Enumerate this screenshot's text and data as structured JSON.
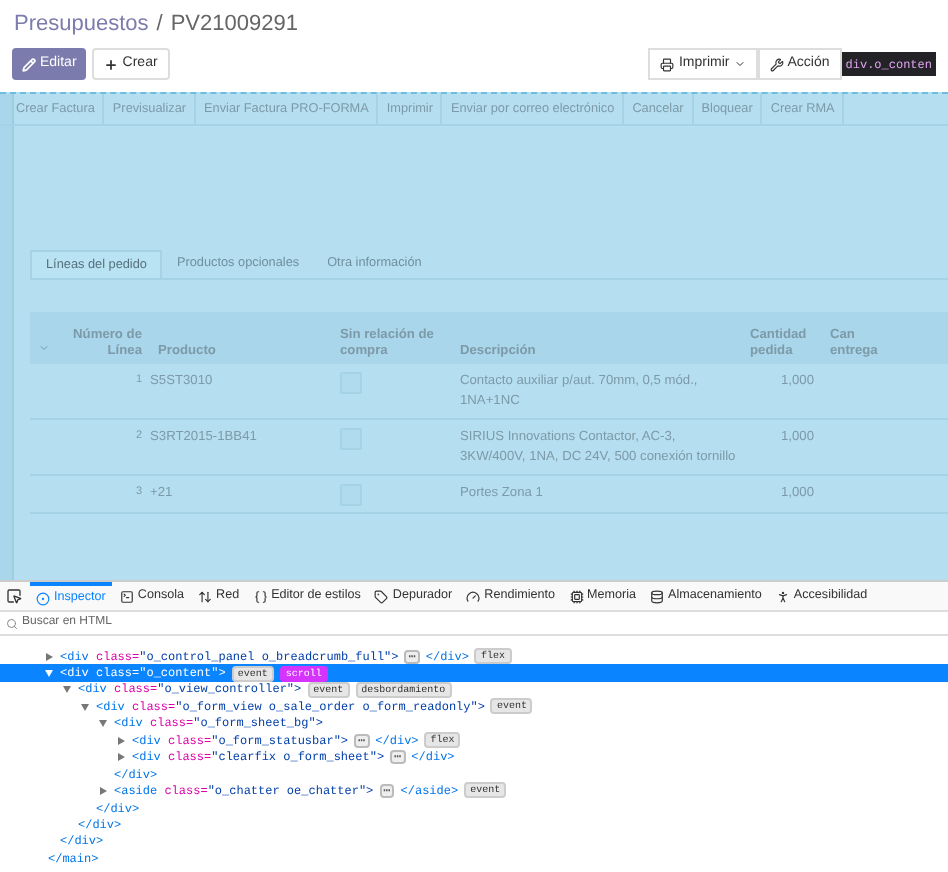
{
  "breadcrumb": {
    "parent": "Presupuestos",
    "separator": "/",
    "current": "PV21009291"
  },
  "buttons": {
    "left": [
      {
        "label": "Editar",
        "kind": "primary"
      },
      {
        "label": "Crear",
        "kind": "create"
      }
    ],
    "right": [
      {
        "label": "Imprimir",
        "kind": "print"
      },
      {
        "label": "Acción",
        "kind": "action"
      }
    ]
  },
  "element_tooltip": "div.o_conten",
  "statusbar_buttons": [
    "Crear Factura",
    "Previsualizar",
    "Enviar Factura PRO-FORMA",
    "Imprimir",
    "Enviar por correo electrónico",
    "Cancelar",
    "Bloquear",
    "Crear RMA"
  ],
  "tabs": [
    {
      "label": "Líneas del pedido",
      "selected": true
    },
    {
      "label": "Productos opcionales",
      "selected": false
    },
    {
      "label": "Otra información",
      "selected": false
    }
  ],
  "table": {
    "columns": [
      "Número de Línea",
      "Producto",
      "Sin relación de compra",
      "Descripción",
      "Cantidad pedida",
      "Can entrega"
    ],
    "rows": [
      {
        "number": "1",
        "product": "S5ST3010",
        "checked": false,
        "description": "Contacto auxiliar p/aut. 70mm, 0,5 mód., 1NA+1NC",
        "quantity": "1,000"
      },
      {
        "number": "2",
        "product": "S3RT2015-1BB41",
        "checked": false,
        "description": "SIRIUS Innovations Contactor, AC-3, 3KW/400V, 1NA, DC 24V, 500 conexión tornillo",
        "quantity": "1,000"
      },
      {
        "number": "3",
        "product": "+21",
        "checked": false,
        "description": "Portes  Zona 1",
        "quantity": "1,000"
      }
    ]
  },
  "devtools": {
    "tools": [
      {
        "label": "Inspector",
        "kind": "inspector",
        "selected": true
      },
      {
        "label": "Consola",
        "kind": "console",
        "selected": false
      },
      {
        "label": "Red",
        "kind": "network",
        "selected": false
      },
      {
        "label": "Editor de estilos",
        "kind": "style",
        "selected": false
      },
      {
        "label": "Depurador",
        "kind": "debugger",
        "selected": false
      },
      {
        "label": "Rendimiento",
        "kind": "performance",
        "selected": false
      },
      {
        "label": "Memoria",
        "kind": "memory",
        "selected": false
      },
      {
        "label": "Almacenamiento",
        "kind": "storage",
        "selected": false
      },
      {
        "label": "Accesibilidad",
        "kind": "accessibility",
        "selected": false
      }
    ],
    "search": {
      "placeholder": "Buscar en HTML"
    },
    "tree": {
      "closing": "</main>",
      "children": [
        {
          "tag": "<div",
          "attr": " class=",
          "value": "\"o_control_panel o_breadcrumb_full\">",
          "expanded": false,
          "selected": false,
          "ellipsis": "⋯",
          "closing": "</div>",
          "badges": [
            {
              "label": "flex",
              "kind": "plain"
            }
          ]
        },
        {
          "tag": "<div",
          "attr": " class=",
          "value": "\"o_content\">",
          "expanded": true,
          "selected": true,
          "closing": "</div>",
          "badges": [
            {
              "label": "event",
              "kind": "plain"
            },
            {
              "label": "scroll",
              "kind": "active"
            }
          ],
          "children": [
            {
              "tag": "<div",
              "attr": " class=",
              "value": "\"o_view_controller\">",
              "expanded": true,
              "selected": false,
              "closing": "</div>",
              "badges": [
                {
                  "label": "event",
                  "kind": "plain"
                },
                {
                  "label": "desbordamiento",
                  "kind": "plain"
                }
              ],
              "children": [
                {
                  "tag": "<div",
                  "attr": " class=",
                  "value": "\"o_form_view o_sale_order o_form_readonly\">",
                  "expanded": true,
                  "selected": false,
                  "closing": "</div>",
                  "badges": [
                    {
                      "label": "event",
                      "kind": "plain"
                    }
                  ],
                  "children": [
                    {
                      "tag": "<div",
                      "attr": " class=",
                      "value": "\"o_form_sheet_bg\">",
                      "expanded": true,
                      "selected": false,
                      "closing": "</div>",
                      "children": [
                        {
                          "tag": "<div",
                          "attr": " class=",
                          "value": "\"o_form_statusbar\">",
                          "expanded": false,
                          "selected": false,
                          "ellipsis": "⋯",
                          "closing": "</div>",
                          "badges": [
                            {
                              "label": "flex",
                              "kind": "plain"
                            }
                          ]
                        },
                        {
                          "tag": "<div",
                          "attr": " class=",
                          "value": "\"clearfix o_form_sheet\">",
                          "expanded": false,
                          "selected": false,
                          "ellipsis": "⋯",
                          "closing": "</div>"
                        }
                      ]
                    },
                    {
                      "tag": "<aside",
                      "attr": " class=",
                      "value": "\"o_chatter oe_chatter\">",
                      "expanded": false,
                      "selected": false,
                      "ellipsis": "⋯",
                      "closing": "</aside>",
                      "badges": [
                        {
                          "label": "event",
                          "kind": "plain"
                        }
                      ]
                    }
                  ]
                }
              ]
            }
          ]
        }
      ]
    }
  }
}
